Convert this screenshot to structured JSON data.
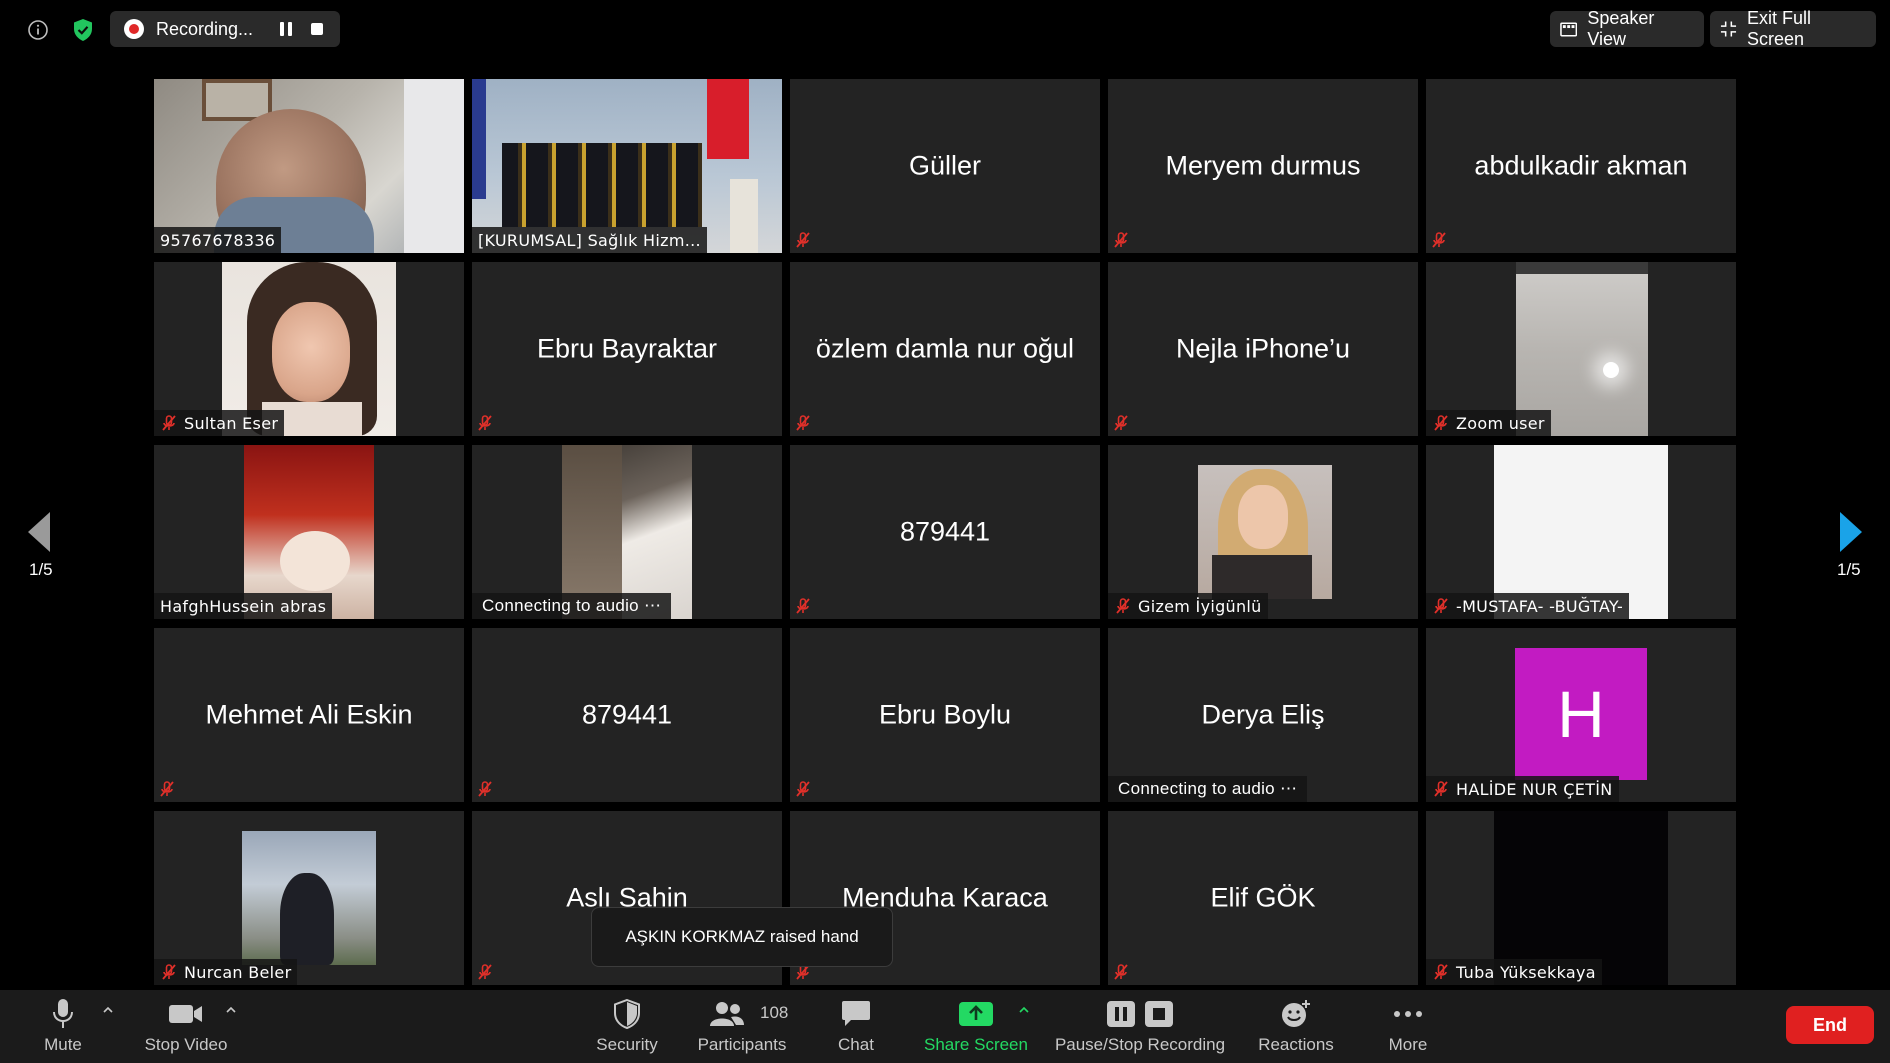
{
  "topbar": {
    "recording_label": "Recording...",
    "speaker_view_label": "Speaker View",
    "exit_fullscreen_label": "Exit Full Screen"
  },
  "pagination": {
    "left": "1/5",
    "right": "1/5"
  },
  "tiles": [
    {
      "label": "95767678336"
    },
    {
      "label": "[KURUMSAL] Sağlık Hizm..."
    },
    {
      "name": "Güller"
    },
    {
      "name": "Meryem durmus"
    },
    {
      "name": "abdulkadir akman"
    },
    {
      "label": "Sultan Eser"
    },
    {
      "name": "Ebru Bayraktar"
    },
    {
      "name": "özlem damla nur oğul"
    },
    {
      "name": "Nejla iPhone’u"
    },
    {
      "label": "Zoom user"
    },
    {
      "label": "HafghHussein abras"
    },
    {
      "label": "Connecting to audio ⋯"
    },
    {
      "name": "879441"
    },
    {
      "label": "Gizem İyigünlü"
    },
    {
      "label": "-MUSTAFA- -BUĞTAY-"
    },
    {
      "name": "Mehmet Ali Eskin"
    },
    {
      "name": "879441"
    },
    {
      "name": "Ebru Boylu"
    },
    {
      "name": "Derya Eliş",
      "label": "Connecting to audio ⋯"
    },
    {
      "label": "HALİDE NUR ÇETİN",
      "avatar_letter": "H"
    },
    {
      "label": "Nurcan Beler"
    },
    {
      "name": "Aslı Sahin"
    },
    {
      "name": "Menduha Karaca"
    },
    {
      "name": "Elif GÖK"
    },
    {
      "label": "Tuba Yüksekkaya"
    }
  ],
  "toast": "AŞKIN KORKMAZ raised hand",
  "toolbar": {
    "mute": "Mute",
    "stop_video": "Stop Video",
    "security": "Security",
    "participants": "Participants",
    "participant_count": "108",
    "chat": "Chat",
    "share_screen": "Share Screen",
    "pause_stop_recording": "Pause/Stop Recording",
    "reactions": "Reactions",
    "more": "More",
    "end": "End"
  },
  "colors": {
    "accent_green": "#23d963",
    "end_red": "#e02020",
    "avatar_purple": "#c21bc2",
    "nav_arrow_blue": "#1aa3e8"
  }
}
